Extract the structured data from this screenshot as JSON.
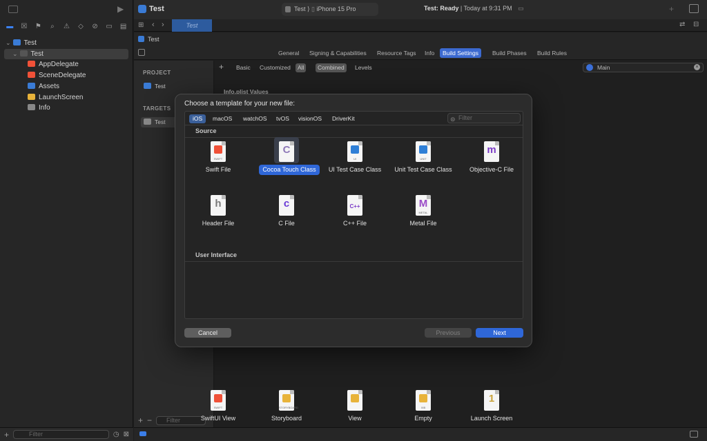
{
  "window": {
    "app_title": "Test"
  },
  "toolbar": {
    "scheme": "Test",
    "device": "iPhone 15 Pro",
    "status_label": "Test: Ready",
    "status_time": "Today at 9:31 PM"
  },
  "navigator": {
    "items": [
      {
        "label": "Test",
        "level": 0
      },
      {
        "label": "Test",
        "level": 1
      },
      {
        "label": "AppDelegate",
        "level": 2
      },
      {
        "label": "SceneDelegate",
        "level": 2
      },
      {
        "label": "Assets",
        "level": 2
      },
      {
        "label": "LaunchScreen",
        "level": 2
      },
      {
        "label": "Info",
        "level": 2
      }
    ],
    "filter_placeholder": "Filter"
  },
  "editor": {
    "tab_label": "Test",
    "breadcrumb": "Test",
    "tabs": [
      "General",
      "Signing & Capabilities",
      "Resource Tags",
      "Info",
      "Build Settings",
      "Build Phases",
      "Build Rules"
    ],
    "active_tab": "Build Settings",
    "filters": [
      "Basic",
      "Customized",
      "All",
      "Combined",
      "Levels"
    ],
    "search_value": "Main",
    "section": "Info.plist Values",
    "project_header": "PROJECT",
    "project_item": "Test",
    "targets_header": "TARGETS",
    "target_item": "Test",
    "sidebar_filter_placeholder": "Filter"
  },
  "dialog": {
    "title": "Choose a template for your new file:",
    "platforms": [
      "iOS",
      "macOS",
      "watchOS",
      "tvOS",
      "visionOS",
      "DriverKit"
    ],
    "selected_platform": "iOS",
    "filter_placeholder": "Filter",
    "sections": [
      {
        "name": "Source",
        "templates": [
          {
            "name": "Swift File",
            "glyph": "",
            "sub": "SWIFT",
            "icon": "swift-file-icon",
            "color": "#f05138"
          },
          {
            "name": "Cocoa Touch Class",
            "glyph": "C",
            "sub": "",
            "icon": "cocoa-touch-class-icon",
            "color": "#8e78b8"
          },
          {
            "name": "UI Test Case Class",
            "glyph": "",
            "sub": "UI",
            "icon": "ui-test-case-icon",
            "color": "#2f7fd6"
          },
          {
            "name": "Unit Test Case Class",
            "glyph": "",
            "sub": "UNIT",
            "icon": "unit-test-case-icon",
            "color": "#2f7fd6"
          },
          {
            "name": "Objective-C File",
            "glyph": "m",
            "sub": "",
            "icon": "objective-c-file-icon",
            "color": "#7b3bc6"
          },
          {
            "name": "Header File",
            "glyph": "h",
            "sub": "",
            "icon": "header-file-icon",
            "color": "#7a7a7a"
          },
          {
            "name": "C File",
            "glyph": "c",
            "sub": "",
            "icon": "c-file-icon",
            "color": "#6a3bd6"
          },
          {
            "name": "C++ File",
            "glyph": "C++",
            "sub": "",
            "icon": "cpp-file-icon",
            "color": "#7b3bc6"
          },
          {
            "name": "Metal File",
            "glyph": "M",
            "sub": "METAL",
            "icon": "metal-file-icon",
            "color": "#9b4cc8"
          }
        ]
      },
      {
        "name": "User Interface",
        "templates": [
          {
            "name": "SwiftUI View",
            "glyph": "",
            "sub": "SWIFT",
            "icon": "swiftui-view-icon",
            "color": "#f05138"
          },
          {
            "name": "Storyboard",
            "glyph": "",
            "sub": "STORYBOARD",
            "icon": "storyboard-icon",
            "color": "#e8b33a"
          },
          {
            "name": "View",
            "glyph": "",
            "sub": "",
            "icon": "view-icon",
            "color": "#e8b33a"
          },
          {
            "name": "Empty",
            "glyph": "",
            "sub": "XIB",
            "icon": "empty-xib-icon",
            "color": "#e8b33a"
          },
          {
            "name": "Launch Screen",
            "glyph": "1",
            "sub": "",
            "icon": "launch-screen-icon",
            "color": "#c9a33b"
          }
        ]
      }
    ],
    "selected_template": "Cocoa Touch Class",
    "buttons": {
      "cancel": "Cancel",
      "previous": "Previous",
      "next": "Next"
    }
  }
}
